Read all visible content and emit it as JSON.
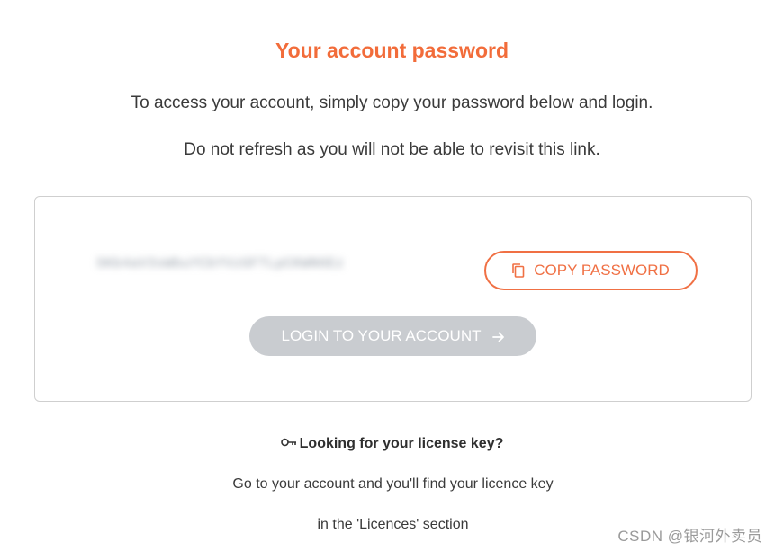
{
  "header": {
    "title": "Your account password",
    "line1": "To access your account, simply copy your password below and login.",
    "line2": "Do not refresh as you will not be able to revisit this link."
  },
  "card": {
    "password_obscured": "SKb4aV3sWbuYCbYVzGFTLpCKWN6Ez",
    "copy_button_label": "COPY PASSWORD",
    "copy_icon": "copy-icon",
    "login_button_label": "LOGIN TO YOUR ACCOUNT",
    "login_icon": "arrow-right-icon"
  },
  "license": {
    "heading": "Looking for your license key?",
    "heading_icon": "key-icon",
    "line1": "Go to your account and you'll find your licence key",
    "line2": "in the 'Licences' section"
  },
  "watermark": {
    "text": "CSDN @银河外卖员"
  },
  "colors": {
    "accent": "#f26c3a",
    "login_disabled_bg": "#c9ccd0",
    "text": "#333333",
    "card_border": "#cfcfcf"
  }
}
